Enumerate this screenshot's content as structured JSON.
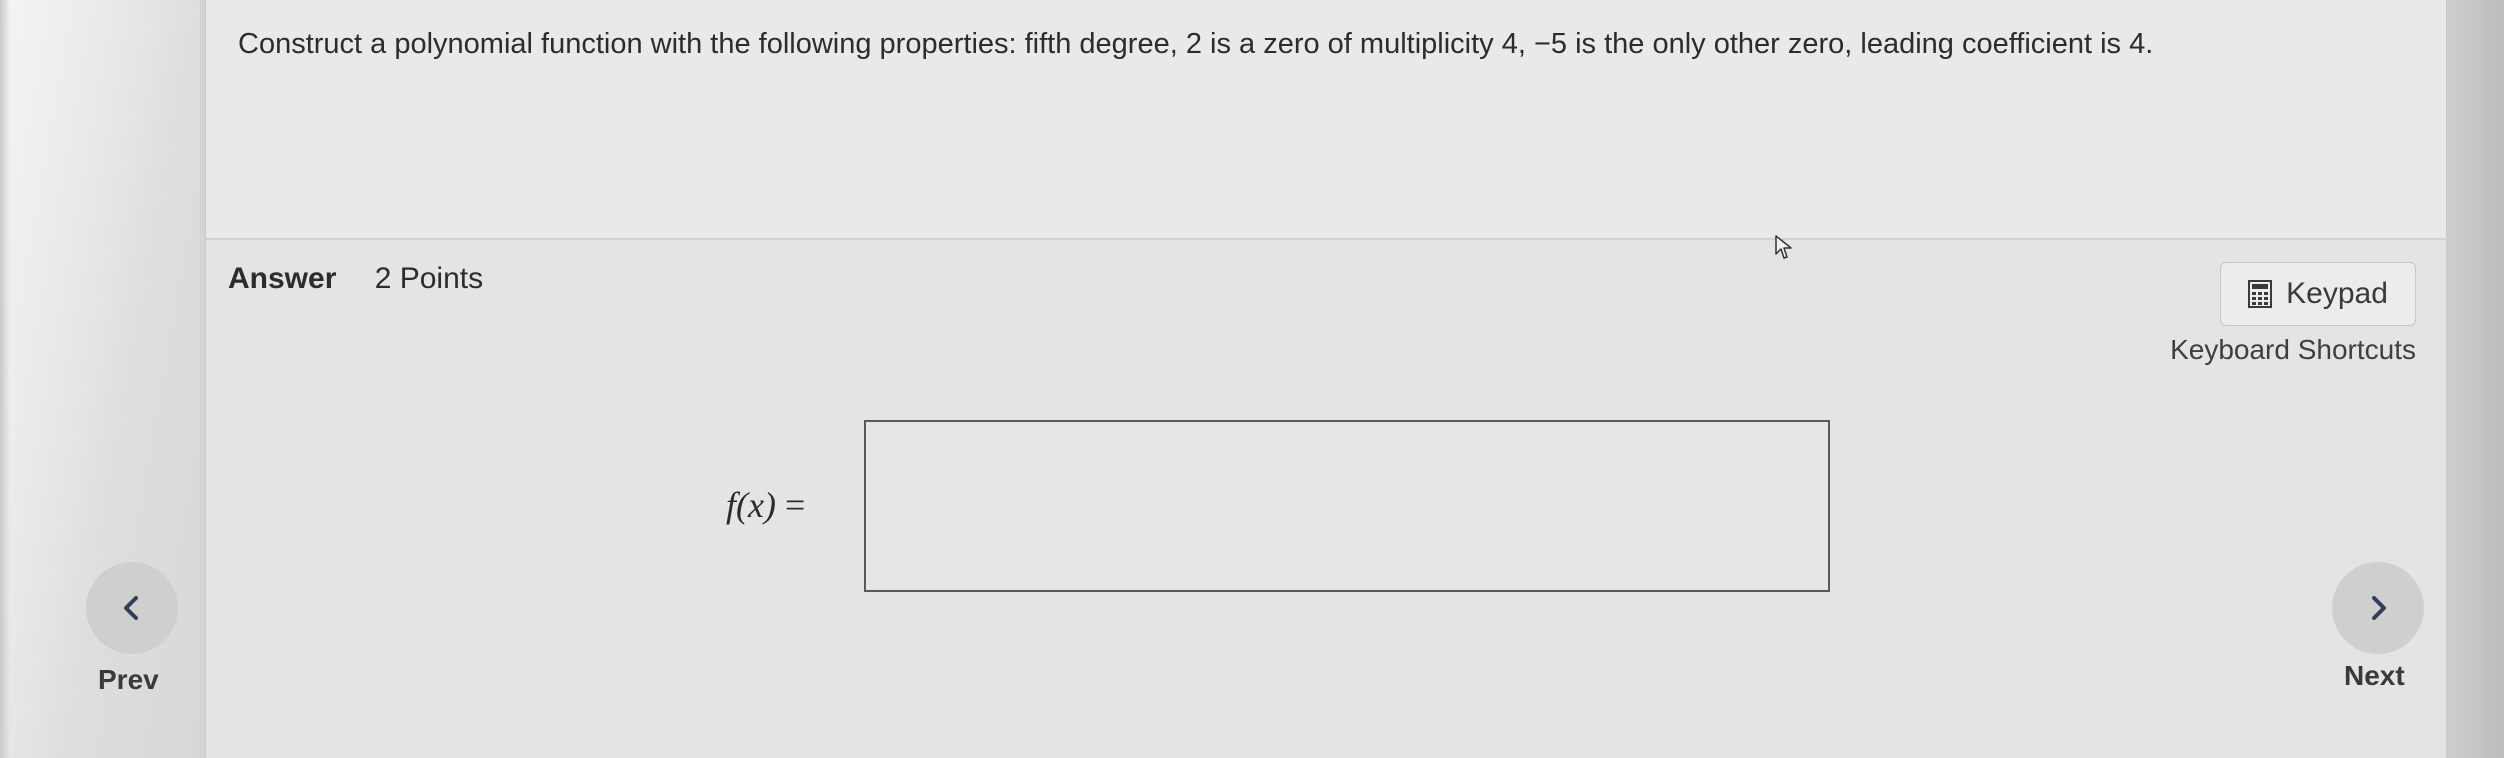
{
  "question": {
    "text": "Construct a polynomial function with the following properties: fifth degree, 2 is a zero of multiplicity 4, −5 is the only other zero, leading coefficient is 4."
  },
  "answer": {
    "label": "Answer",
    "points": "2 Points",
    "input_value": "",
    "function_name": "f(x)",
    "equals": "="
  },
  "toolbar": {
    "keypad_label": "Keypad",
    "shortcuts_label": "Keyboard Shortcuts"
  },
  "navigation": {
    "prev_label": "Prev",
    "next_label": "Next"
  },
  "icons": {
    "keypad": "calculator-icon",
    "prev": "chevron-left-icon",
    "next": "chevron-right-icon"
  }
}
